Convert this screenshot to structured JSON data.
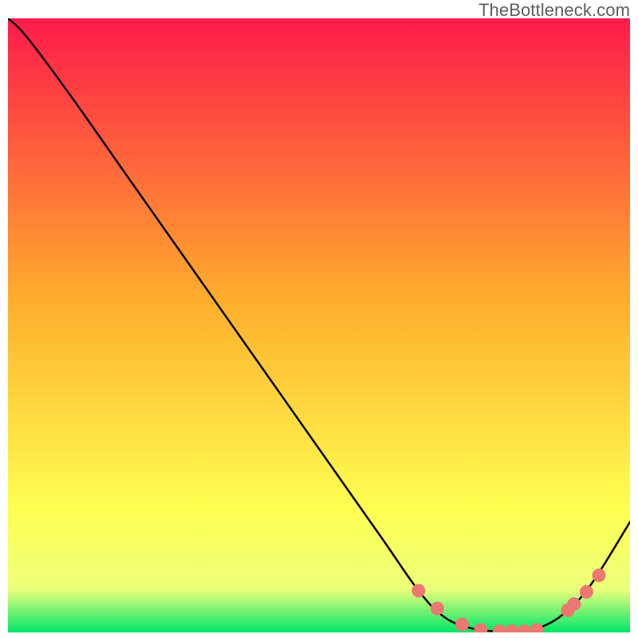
{
  "attribution": "TheBottleneck.com",
  "colors": {
    "frame": "#000000",
    "curve": "#000000",
    "dot_fill": "#ed7771",
    "dot_stroke": "#ed7771",
    "gradient_top": "#ff1a4a",
    "gradient_mid1": "#ffae2c",
    "gradient_mid2": "#ffff50",
    "gradient_mid3": "#eaff7a",
    "gradient_bottom": "#00e66a"
  },
  "chart_data": {
    "type": "line",
    "title": "",
    "xlabel": "",
    "ylabel": "",
    "x": [
      0.0,
      0.03,
      0.1,
      0.2,
      0.3,
      0.4,
      0.5,
      0.6,
      0.66,
      0.7,
      0.74,
      0.78,
      0.82,
      0.86,
      0.9,
      0.94,
      1.0
    ],
    "values": [
      1.0,
      0.97,
      0.875,
      0.731,
      0.587,
      0.443,
      0.299,
      0.155,
      0.068,
      0.026,
      0.008,
      0.002,
      0.002,
      0.01,
      0.036,
      0.082,
      0.18
    ],
    "xlim": [
      0,
      1
    ],
    "ylim": [
      0,
      1
    ],
    "dots": {
      "x": [
        0.66,
        0.69,
        0.73,
        0.76,
        0.79,
        0.81,
        0.83,
        0.85,
        0.9,
        0.91,
        0.93,
        0.95
      ],
      "y": [
        0.068,
        0.039,
        0.013,
        0.004,
        0.002,
        0.002,
        0.002,
        0.004,
        0.036,
        0.046,
        0.066,
        0.093
      ]
    }
  }
}
